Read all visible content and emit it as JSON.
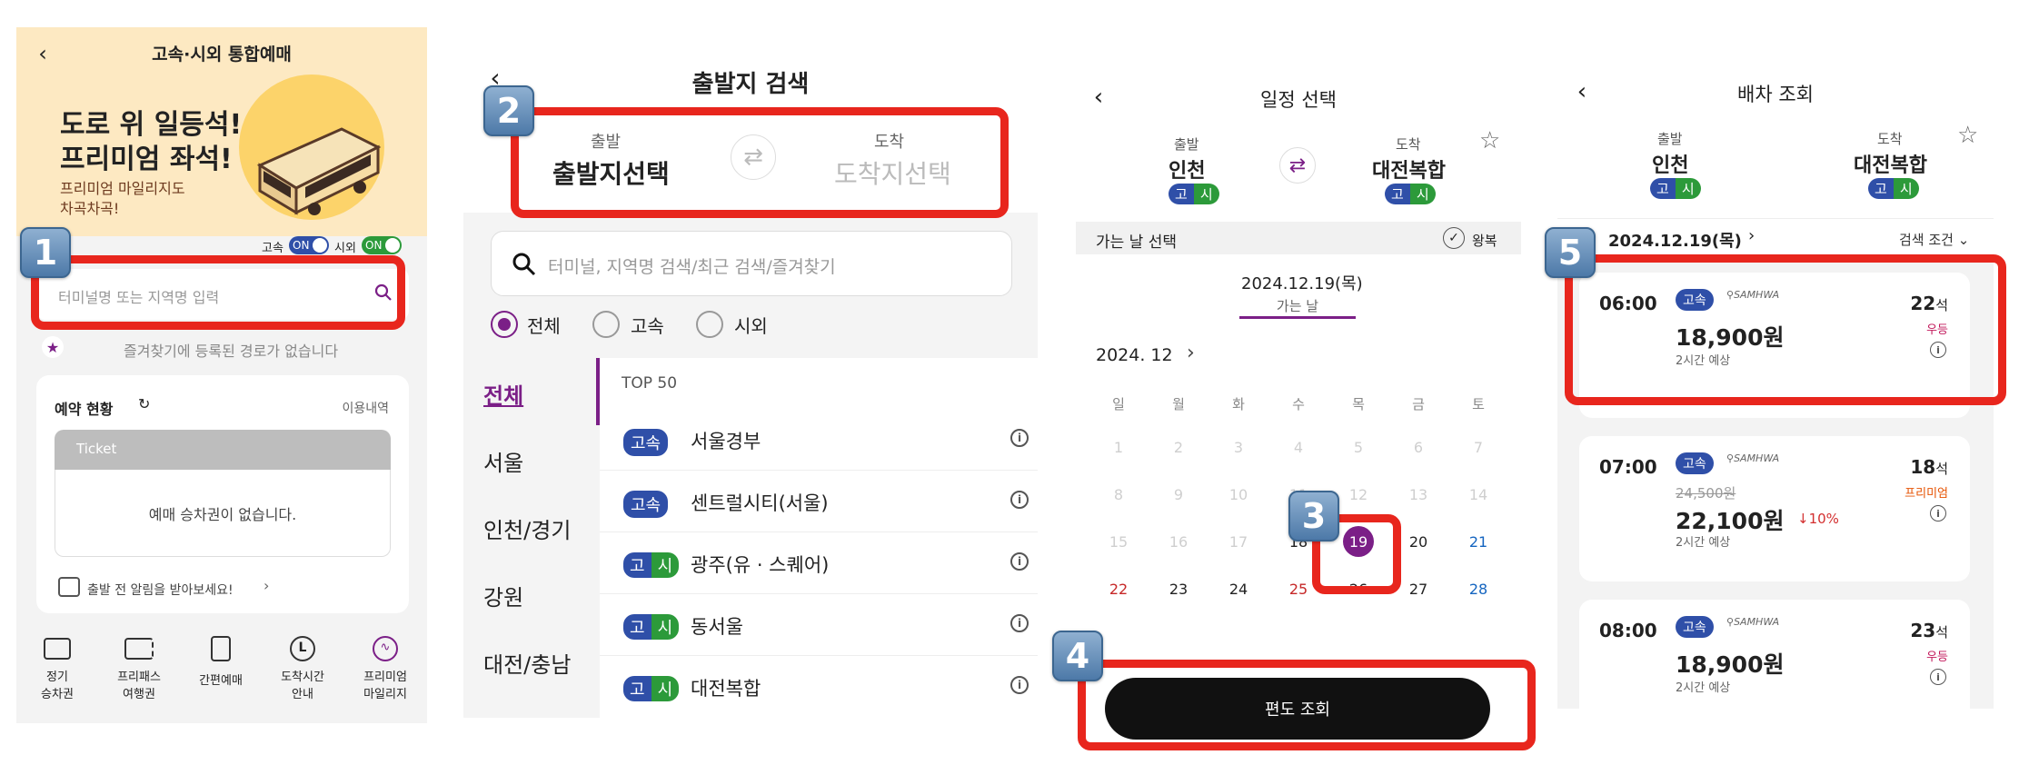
{
  "p1": {
    "title": "고속·시외 통합예매",
    "banner_line1": "도로 위 일등석!",
    "banner_line2": "프리미엄 좌석!",
    "banner_sub1": "프리미엄 마일리지도",
    "banner_sub2": "차곡차곡!",
    "toggle1_label": "고속",
    "toggle1_state": "ON",
    "toggle2_label": "시외",
    "toggle2_state": "ON",
    "search_placeholder": "터미널명 또는 지역명 입력",
    "favorites_empty": "즐겨찾기에 등록된 경로가 없습니다",
    "reservation_title": "예약 현황",
    "history_link": "이용내역",
    "ticket_label": "Ticket",
    "no_ticket": "예매 승차권이 없습니다.",
    "alert_text": "출발 전 알림을 받아보세요!",
    "bottom_nav": [
      {
        "line1": "정기",
        "line2": "승차권",
        "icon": "wallet-icon"
      },
      {
        "line1": "프리패스",
        "line2": "여행권",
        "icon": "ticket-icon"
      },
      {
        "line1": "간편예매",
        "line2": "",
        "icon": "phone-ticket-icon"
      },
      {
        "line1": "도착시간",
        "line2": "안내",
        "icon": "clock-icon"
      },
      {
        "line1": "프리미엄",
        "line2": "마일리지",
        "icon": "mileage-icon"
      }
    ]
  },
  "p2": {
    "title": "출발지 검색",
    "dep_label": "출발",
    "dep_value": "출발지선택",
    "arr_label": "도착",
    "arr_value": "도착지선택",
    "search_placeholder": "터미널, 지역명 검색/최근 검색/즐겨찾기",
    "radios": [
      "전체",
      "고속",
      "시외"
    ],
    "regions": [
      "전체",
      "서울",
      "인천/경기",
      "강원",
      "대전/충남"
    ],
    "top_label": "TOP 50",
    "terminals": [
      {
        "type": "고속",
        "name": "서울경부"
      },
      {
        "type": "고속",
        "name": "센트럴시티(서울)"
      },
      {
        "type": "고시",
        "name": "광주(유 · 스퀘어)"
      },
      {
        "type": "고시",
        "name": "동서울"
      },
      {
        "type": "고시",
        "name": "대전복합"
      }
    ]
  },
  "p3": {
    "title": "일정 선택",
    "dep_label": "출발",
    "dep_value": "인천",
    "arr_label": "도착",
    "arr_value": "대전복합",
    "go_select": "가는 날 선택",
    "round_trip": "왕복",
    "selected_date": "2024.12.19(목)",
    "go_day": "가는 날",
    "month": "2024. 12",
    "weekdays": [
      "일",
      "월",
      "화",
      "수",
      "목",
      "금",
      "토"
    ],
    "weeks": [
      [
        "1",
        "2",
        "3",
        "4",
        "5",
        "6",
        "7"
      ],
      [
        "8",
        "9",
        "10",
        "11",
        "12",
        "13",
        "14"
      ],
      [
        "15",
        "16",
        "17",
        "18",
        "19",
        "20",
        "21"
      ],
      [
        "22",
        "23",
        "24",
        "25",
        "26",
        "27",
        "28"
      ]
    ],
    "search_button": "편도 조회"
  },
  "p4": {
    "title": "배차 조회",
    "dep_label": "출발",
    "dep_value": "인천",
    "arr_label": "도착",
    "arr_value": "대전복합",
    "date": "2024.12.19(목)",
    "filter": "검색 조건",
    "results": [
      {
        "time": "06:00",
        "badge": "고속",
        "company": "SAMHWA",
        "price": "18,900원",
        "old_price": "",
        "discount": "",
        "duration": "2시간 예상",
        "seats": "22",
        "seat_unit": "석",
        "grade": "우등",
        "grade_color": "#c2185b"
      },
      {
        "time": "07:00",
        "badge": "고속",
        "company": "SAMHWA",
        "price": "22,100원",
        "old_price": "24,500원",
        "discount": "↓10%",
        "duration": "2시간 예상",
        "seats": "18",
        "seat_unit": "석",
        "grade": "프리미엄",
        "grade_color": "#e65100"
      },
      {
        "time": "08:00",
        "badge": "고속",
        "company": "SAMHWA",
        "price": "18,900원",
        "old_price": "",
        "discount": "",
        "duration": "2시간 예상",
        "seats": "23",
        "seat_unit": "석",
        "grade": "우등",
        "grade_color": "#c2185b"
      }
    ]
  },
  "steps": [
    "1",
    "2",
    "3",
    "4",
    "5"
  ],
  "colors": {
    "accent": "#7b1f87",
    "highlight": "#e8261d",
    "express": "#2f4fa8",
    "intercity": "#2c9a3a",
    "banner": "#fde9c2"
  }
}
